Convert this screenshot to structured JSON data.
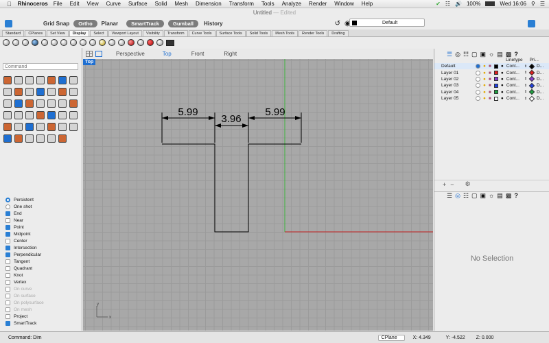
{
  "menubar": {
    "app": "Rhinoceros",
    "items": [
      "File",
      "Edit",
      "View",
      "Curve",
      "Surface",
      "Solid",
      "Mesh",
      "Dimension",
      "Transform",
      "Tools",
      "Analyze",
      "Render",
      "Window",
      "Help"
    ],
    "battery": "100%",
    "clock": "Wed 16:06"
  },
  "window": {
    "title": "Untitled",
    "status": "— Edited"
  },
  "toolbar": {
    "grid_snap": "Grid Snap",
    "ortho": "Ortho",
    "planar": "Planar",
    "smarttrack": "SmartTrack",
    "gumball": "Gumball",
    "history": "History",
    "layer": "Default"
  },
  "tabs": [
    "Standard",
    "CPlanes",
    "Set View",
    "Display",
    "Select",
    "Viewport Layout",
    "Visibility",
    "Transform",
    "Curve Tools",
    "Surface Tools",
    "Solid Tools",
    "Mesh Tools",
    "Render Tools",
    "Drafting"
  ],
  "command": {
    "placeholder": "Command"
  },
  "viewports": {
    "tabs": [
      "Perspective",
      "Top",
      "Front",
      "Right"
    ],
    "active_label": "Top",
    "axis_x": "x",
    "axis_y": "y"
  },
  "dimensions": [
    "5.99",
    "3.96",
    "5.99"
  ],
  "osnap": {
    "modes": [
      {
        "label": "Persistent",
        "type": "radio",
        "checked": true,
        "enabled": true
      },
      {
        "label": "One shot",
        "type": "radio",
        "checked": false,
        "enabled": true
      },
      {
        "label": "End",
        "type": "check",
        "checked": true,
        "enabled": true
      },
      {
        "label": "Near",
        "type": "check",
        "checked": false,
        "enabled": true
      },
      {
        "label": "Point",
        "type": "check",
        "checked": true,
        "enabled": true
      },
      {
        "label": "Midpoint",
        "type": "check",
        "checked": true,
        "enabled": true
      },
      {
        "label": "Center",
        "type": "check",
        "checked": false,
        "enabled": true
      },
      {
        "label": "Intersection",
        "type": "check",
        "checked": true,
        "enabled": true
      },
      {
        "label": "Perpendicular",
        "type": "check",
        "checked": true,
        "enabled": true
      },
      {
        "label": "Tangent",
        "type": "check",
        "checked": false,
        "enabled": true
      },
      {
        "label": "Quadrant",
        "type": "check",
        "checked": false,
        "enabled": true
      },
      {
        "label": "Knot",
        "type": "check",
        "checked": false,
        "enabled": true
      },
      {
        "label": "Vertex",
        "type": "check",
        "checked": false,
        "enabled": true
      },
      {
        "label": "On curve",
        "type": "check",
        "checked": false,
        "enabled": false
      },
      {
        "label": "On surface",
        "type": "check",
        "checked": false,
        "enabled": false
      },
      {
        "label": "On polysurface",
        "type": "check",
        "checked": false,
        "enabled": false
      },
      {
        "label": "On mesh",
        "type": "check",
        "checked": false,
        "enabled": false
      },
      {
        "label": "Project",
        "type": "check",
        "checked": false,
        "enabled": true
      },
      {
        "label": "SmartTrack",
        "type": "check",
        "checked": true,
        "enabled": true
      }
    ]
  },
  "layers": {
    "columns": {
      "linetype": "Linetype",
      "print": "Pri..."
    },
    "rows": [
      {
        "name": "Default",
        "color": "#000000",
        "linetype": "Cont...",
        "print": "D...",
        "current": true
      },
      {
        "name": "Layer 01",
        "color": "#e02020",
        "linetype": "Cont...",
        "print": "D...",
        "current": false
      },
      {
        "name": "Layer 02",
        "color": "#8a3fd0",
        "linetype": "Cont...",
        "print": "D...",
        "current": false
      },
      {
        "name": "Layer 03",
        "color": "#2040e0",
        "linetype": "Cont...",
        "print": "D...",
        "current": false
      },
      {
        "name": "Layer 04",
        "color": "#20a040",
        "linetype": "Cont...",
        "print": "D...",
        "current": false
      },
      {
        "name": "Layer 05",
        "color": "#ffffff",
        "linetype": "Cont...",
        "print": "D...",
        "current": false
      }
    ]
  },
  "properties": {
    "empty_text": "No Selection"
  },
  "status": {
    "command": "Command: Dim",
    "cplane": "CPlane",
    "x": "X: 4.349",
    "y": "Y: -4.522",
    "z": "Z: 0.000"
  }
}
